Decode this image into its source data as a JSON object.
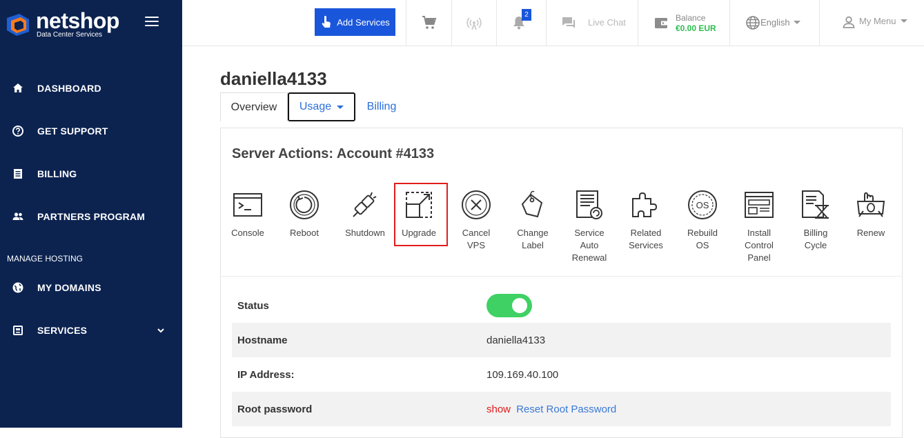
{
  "brand": {
    "name": "netshop",
    "tagline": "Data Center Services"
  },
  "sidebar": {
    "items": [
      {
        "label": "DASHBOARD",
        "icon": "home-icon"
      },
      {
        "label": "GET SUPPORT",
        "icon": "help-circle-icon"
      },
      {
        "label": "BILLING",
        "icon": "document-icon"
      },
      {
        "label": "PARTNERS PROGRAM",
        "icon": "people-icon"
      }
    ],
    "section_label": "MANAGE HOSTING",
    "hosting_items": [
      {
        "label": "MY DOMAINS",
        "icon": "globe-icon"
      },
      {
        "label": "SERVICES",
        "icon": "server-icon"
      }
    ]
  },
  "topbar": {
    "add_services": "Add Services",
    "notifications_count": "2",
    "live_chat": "Live Chat",
    "balance_label": "Balance",
    "balance_value": "€0.00 EUR",
    "language": "English",
    "my_menu": "My Menu"
  },
  "page": {
    "title": "daniella4133",
    "tabs": [
      "Overview",
      "Usage",
      "Billing"
    ],
    "server_actions_title": "Server Actions: Account #4133"
  },
  "actions": [
    {
      "label": "Console",
      "icon": "console-icon"
    },
    {
      "label": "Reboot",
      "icon": "reboot-icon"
    },
    {
      "label": "Shutdown",
      "icon": "power-plug-icon"
    },
    {
      "label": "Upgrade",
      "icon": "upgrade-icon"
    },
    {
      "label": "Cancel VPS",
      "icon": "cancel-circle-icon"
    },
    {
      "label": "Change Label",
      "icon": "tag-icon"
    },
    {
      "label": "Service Auto Renewal",
      "icon": "auto-renew-icon"
    },
    {
      "label": "Related Services",
      "icon": "puzzle-icon"
    },
    {
      "label": "Rebuild OS",
      "icon": "os-disc-icon"
    },
    {
      "label": "Install Control Panel",
      "icon": "control-panel-icon"
    },
    {
      "label": "Billing Cycle",
      "icon": "billing-cycle-icon"
    },
    {
      "label": "Renew",
      "icon": "renew-icon"
    }
  ],
  "details": {
    "status_label": "Status",
    "status_on": true,
    "hostname_label": "Hostname",
    "hostname_value": "daniella4133",
    "ip_label": "IP Address:",
    "ip_value": "109.169.40.100",
    "root_label": "Root password",
    "show_link": "show",
    "reset_link": "Reset Root Password"
  },
  "colors": {
    "sidebar_bg": "#0c2350",
    "primary": "#1a56db",
    "toggle_on": "#3fd163",
    "balance": "#2bbc4e",
    "highlight": "#e21b1b"
  }
}
